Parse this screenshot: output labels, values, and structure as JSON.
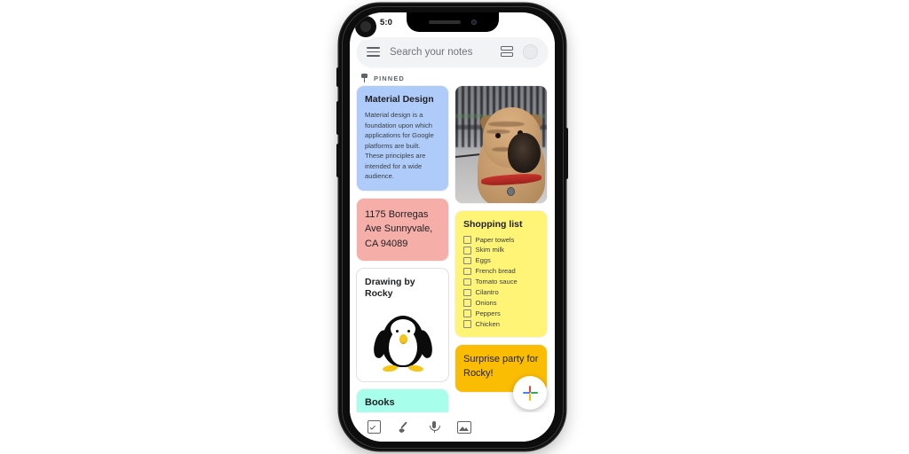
{
  "status": {
    "time": "5:0",
    "camera_icon": "front-camera-blob",
    "speaker_icon": "earpiece-speaker"
  },
  "search": {
    "menu_icon": "hamburger-menu-icon",
    "placeholder": "Search your notes",
    "view_toggle_icon": "list-view-toggle-icon",
    "avatar_icon": "account-avatar"
  },
  "sections": {
    "pinned_label": "PINNED",
    "pin_icon": "pin-icon"
  },
  "notes": {
    "material_design": {
      "title": "Material Design",
      "body": "Material design is a foundation upon which applications for Google platforms are built. These principles are intended for a wide audience.",
      "color": "#aecbfa"
    },
    "dog_photo": {
      "alt": "photo of a shar pei dog with red collar",
      "color": "#8d8d8d"
    },
    "address": {
      "text": "1175 Borregas Ave Sunnyvale, CA 94089",
      "color": "#f6aea9"
    },
    "shopping_list": {
      "title": "Shopping list",
      "color": "#fff475",
      "items": [
        "Paper towels",
        "Skim milk",
        "Eggs",
        "French bread",
        "Tomato sauce",
        "Cilantro",
        "Onions",
        "Peppers",
        "Chicken"
      ]
    },
    "drawing": {
      "title": "Drawing by Rocky",
      "alt": "penguin drawing",
      "color": "#ffffff"
    },
    "surprise": {
      "text": "Surprise party for Rocky!",
      "color": "#fbbc04"
    },
    "books": {
      "title": "Books",
      "color": "#a7ffeb"
    }
  },
  "fab": {
    "name": "create-note-button",
    "icon": "google-plus-icon",
    "colors": [
      "#4285f4",
      "#34a853",
      "#ea4335",
      "#fbbc04"
    ]
  },
  "toolbar": {
    "items": [
      {
        "icon": "new-checklist-icon",
        "label": "New list"
      },
      {
        "icon": "new-drawing-icon",
        "label": "New drawing"
      },
      {
        "icon": "new-voice-note-icon",
        "label": "New recording"
      },
      {
        "icon": "new-image-note-icon",
        "label": "New image note"
      }
    ]
  }
}
